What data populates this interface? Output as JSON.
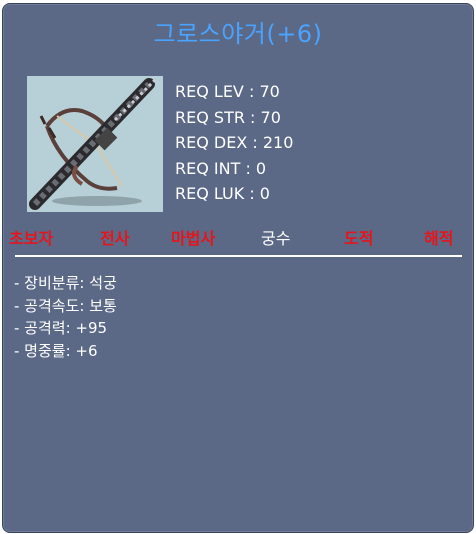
{
  "item": {
    "title": "그로스야거(+6)",
    "icon": "crossbow-icon"
  },
  "requirements": [
    "REQ LEV : 70",
    "REQ STR : 70",
    "REQ DEX : 210",
    "REQ INT : 0",
    "REQ LUK : 0"
  ],
  "jobs": [
    {
      "label": "초보자",
      "active": false
    },
    {
      "label": "전사",
      "active": false
    },
    {
      "label": "마법사",
      "active": false
    },
    {
      "label": "궁수",
      "active": true
    },
    {
      "label": "도적",
      "active": false
    },
    {
      "label": "해적",
      "active": false
    }
  ],
  "stats": [
    "- 장비분류: 석궁",
    "- 공격속도: 보통",
    "- 공격력: +95",
    "- 명중률: +6"
  ],
  "colors": {
    "panel": "#5b6886",
    "title": "#4aa3ff",
    "job_inactive": "#e8141c",
    "job_active": "#ffffff"
  }
}
